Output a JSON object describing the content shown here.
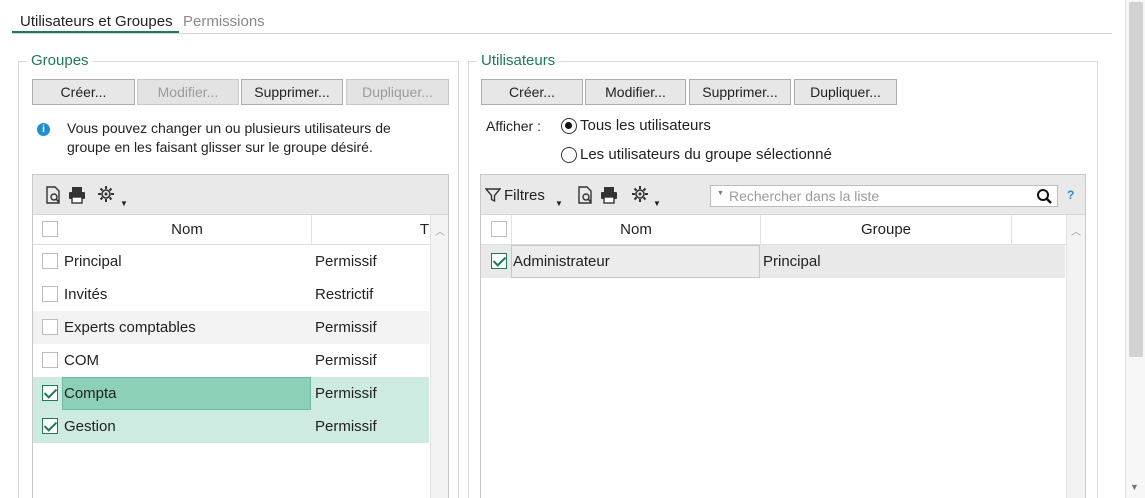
{
  "tabs": [
    {
      "label": "Utilisateurs et Groupes",
      "active": true
    },
    {
      "label": "Permissions",
      "active": false
    }
  ],
  "groups": {
    "title": "Groupes",
    "buttons": {
      "create": "Créer...",
      "edit": "Modifier...",
      "delete": "Supprimer...",
      "duplicate": "Dupliquer..."
    },
    "info_line1": "Vous pouvez changer un ou plusieurs utilisateurs de",
    "info_line2": "groupe en les faisant glisser sur le groupe désiré.",
    "columns": {
      "name": "Nom",
      "type": "T"
    },
    "rows": [
      {
        "name": "Principal",
        "type": "Permissif",
        "checked": false
      },
      {
        "name": "Invités",
        "type": "Restrictif",
        "checked": false
      },
      {
        "name": "Experts comptables",
        "type": "Permissif",
        "checked": false
      },
      {
        "name": "COM",
        "type": "Permissif",
        "checked": false
      },
      {
        "name": "Compta",
        "type": "Permissif",
        "checked": true
      },
      {
        "name": "Gestion",
        "type": "Permissif",
        "checked": true
      }
    ]
  },
  "users": {
    "title": "Utilisateurs",
    "buttons": {
      "create": "Créer...",
      "edit": "Modifier...",
      "delete": "Supprimer...",
      "duplicate": "Dupliquer..."
    },
    "show_label": "Afficher :",
    "radio_all": "Tous les utilisateurs",
    "radio_group": "Les utilisateurs du groupe sélectionné",
    "filters_label": "Filtres",
    "search_placeholder": "Rechercher dans la liste",
    "help_mark": "?",
    "columns": {
      "name": "Nom",
      "group": "Groupe"
    },
    "rows": [
      {
        "name": "Administrateur",
        "group": "Principal",
        "checked": true
      }
    ]
  },
  "icons": {
    "info": "info-icon",
    "preview": "print-preview-icon",
    "print": "printer-icon",
    "settings": "gear-icon",
    "filter": "funnel-icon",
    "search": "magnifier-icon"
  },
  "colors": {
    "accent": "#1e7a58",
    "selected_row": "#cdebe0",
    "selected_cell": "#8bd0b7",
    "info": "#1e8fd0"
  }
}
